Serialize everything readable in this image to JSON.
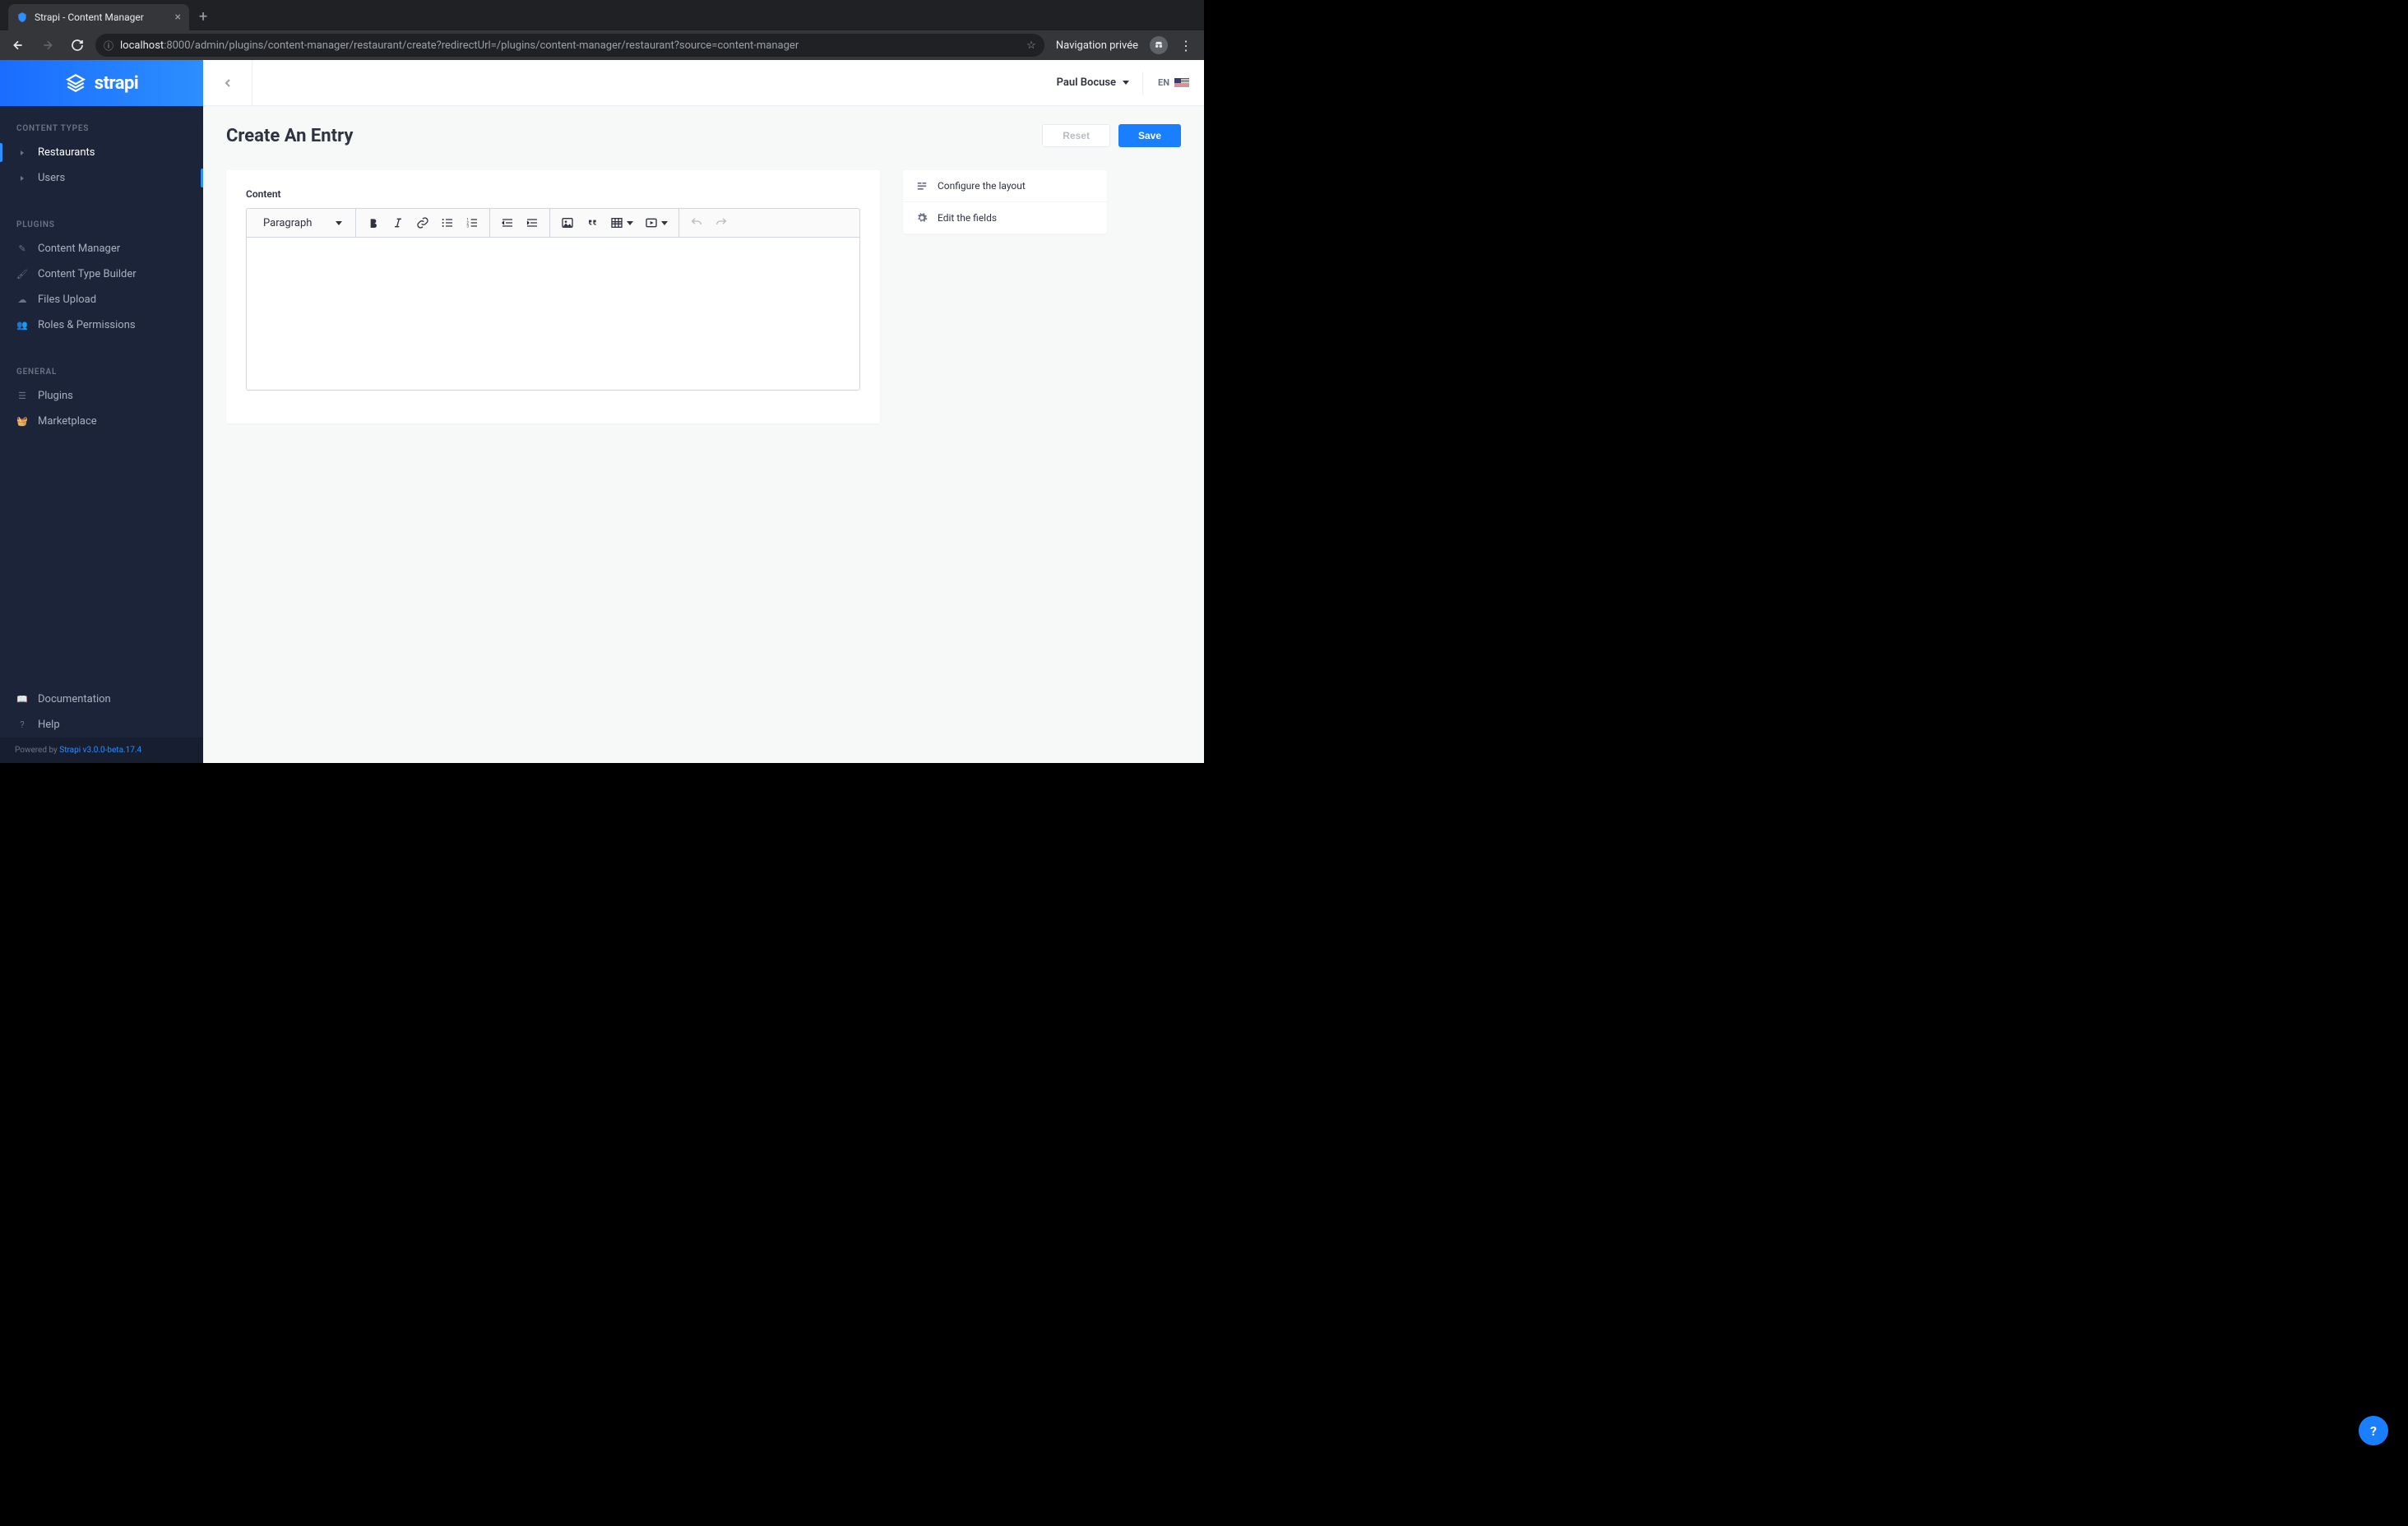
{
  "browser": {
    "tab_title": "Strapi - Content Manager",
    "url_host": "localhost",
    "url_port_path": ":8000/admin/plugins/content-manager/restaurant/create?redirectUrl=/plugins/content-manager/restaurant?source=content-manager",
    "incognito_label": "Navigation privée"
  },
  "logo": {
    "text": "strapi"
  },
  "sidebar": {
    "sections": {
      "content_types": {
        "heading": "CONTENT TYPES",
        "items": [
          "Restaurants",
          "Users"
        ]
      },
      "plugins": {
        "heading": "PLUGINS",
        "items": [
          "Content Manager",
          "Content Type Builder",
          "Files Upload",
          "Roles & Permissions"
        ]
      },
      "general": {
        "heading": "GENERAL",
        "items": [
          "Plugins",
          "Marketplace"
        ]
      }
    },
    "footer_items": [
      "Documentation",
      "Help"
    ],
    "powered_prefix": "Powered by ",
    "powered_link": "Strapi v3.0.0-beta.17.4"
  },
  "topbar": {
    "user_name": "Paul Bocuse",
    "lang": "EN"
  },
  "page": {
    "title": "Create An Entry",
    "reset_label": "Reset",
    "save_label": "Save"
  },
  "editor": {
    "field_label": "Content",
    "heading_dropdown": "Paragraph"
  },
  "side_panel": {
    "configure_label": "Configure the layout",
    "edit_fields_label": "Edit the fields"
  },
  "help_fab": "?"
}
